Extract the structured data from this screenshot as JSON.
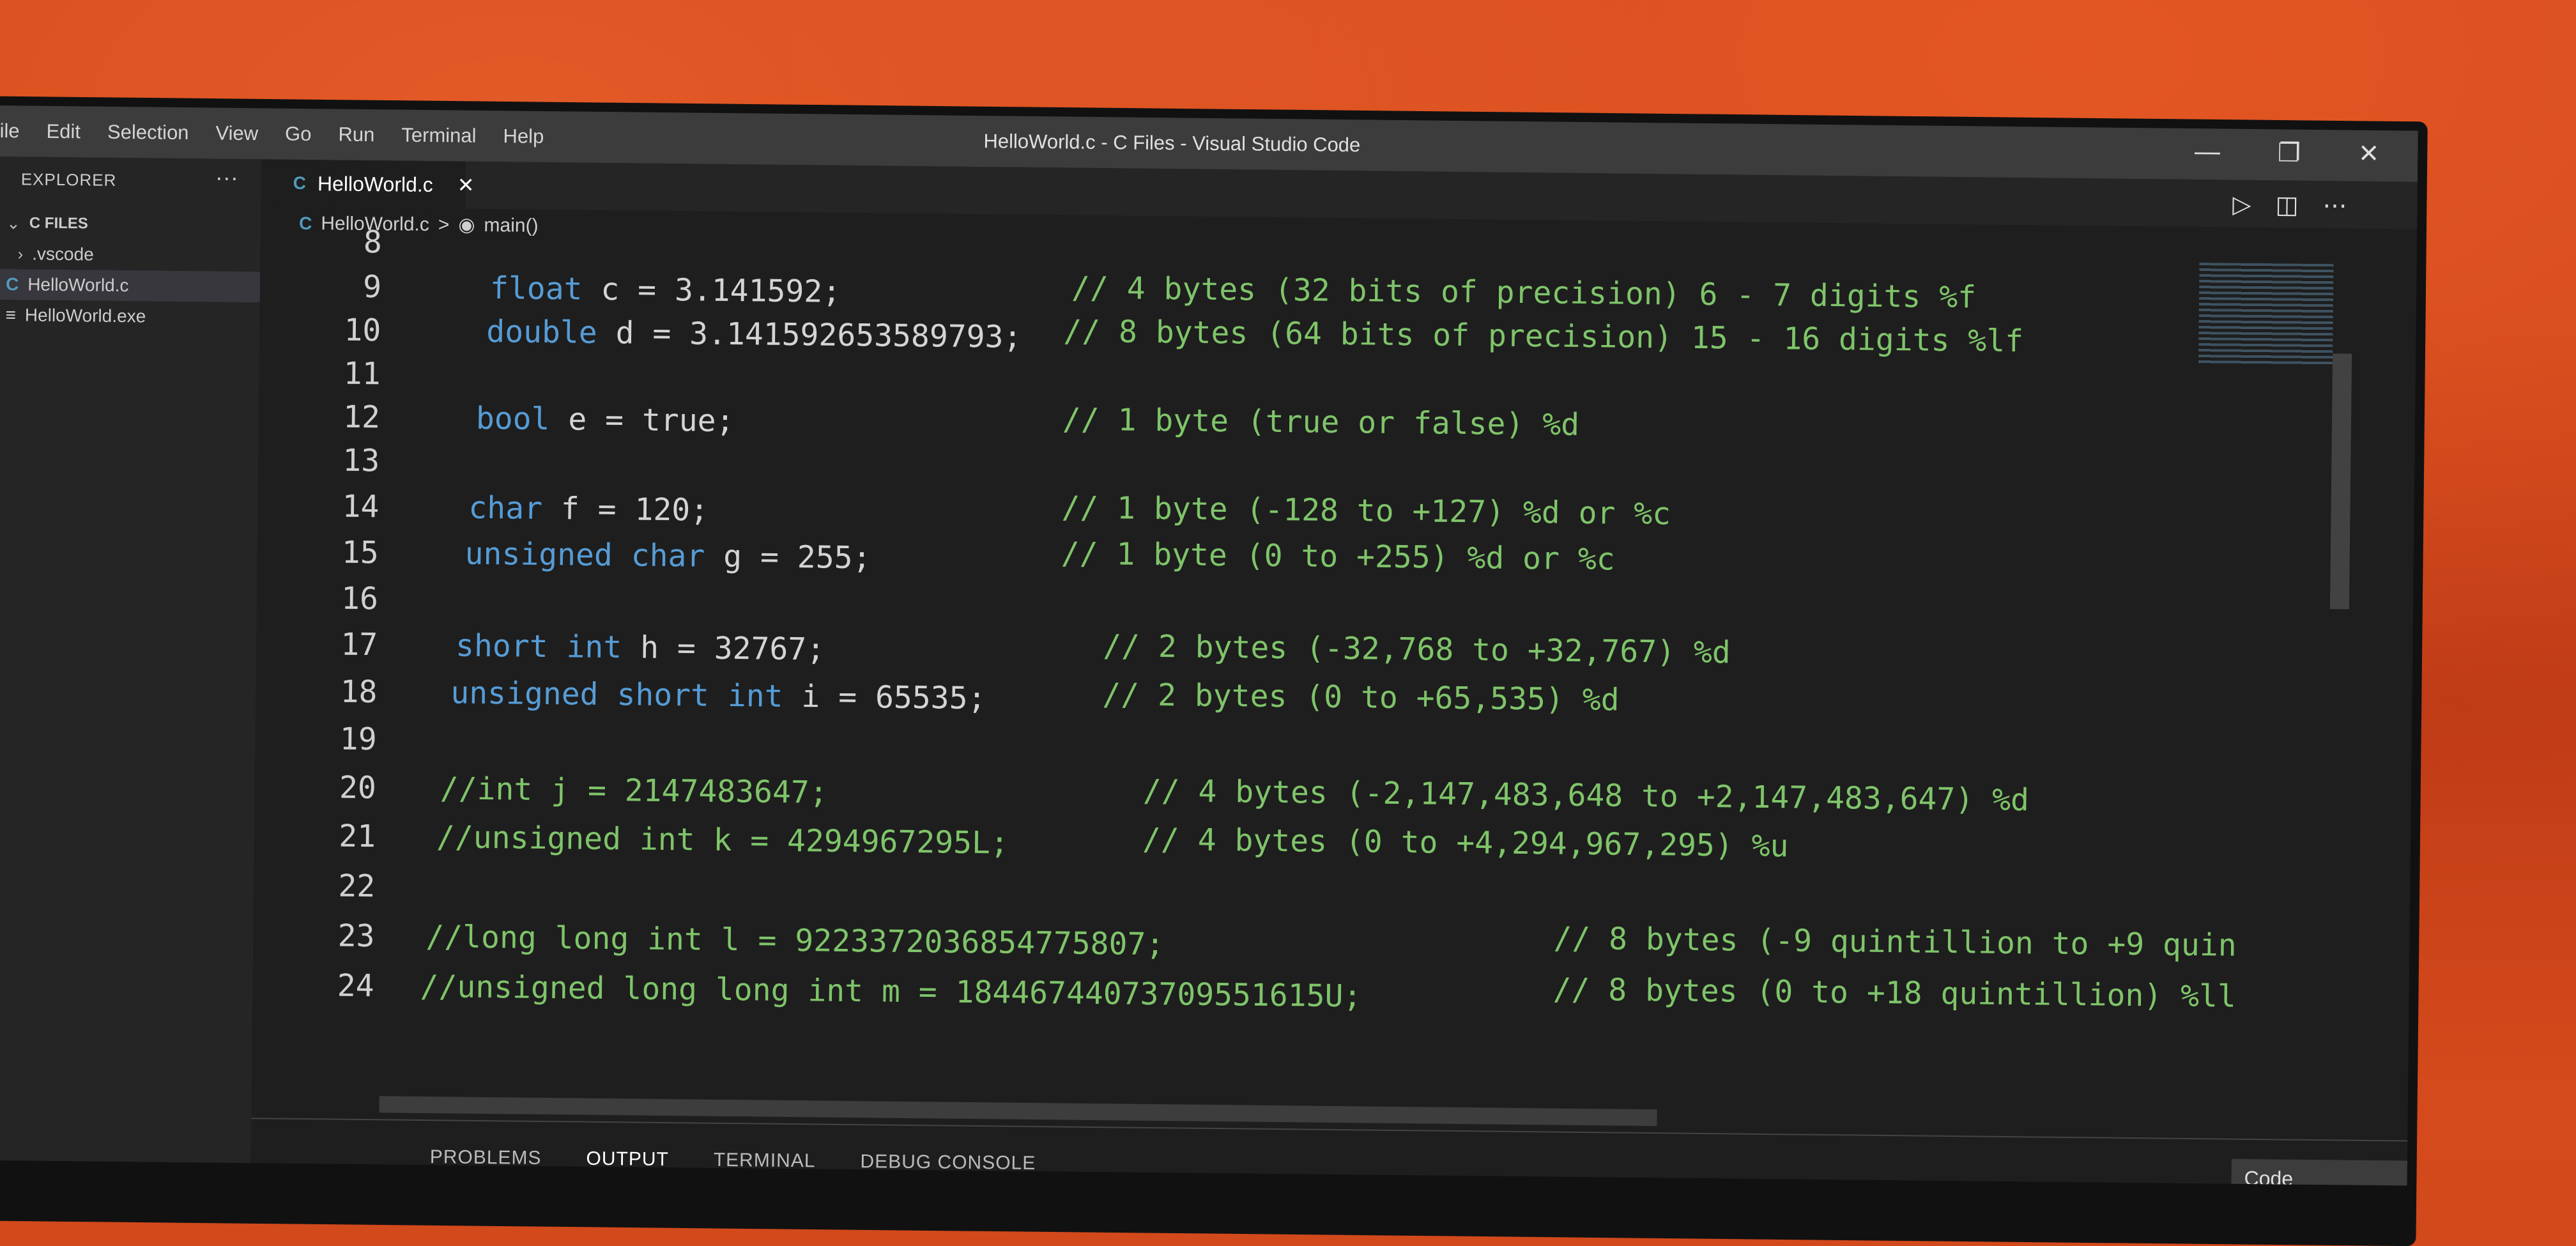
{
  "titlebar": {
    "menu": [
      "ile",
      "Edit",
      "Selection",
      "View",
      "Go",
      "Run",
      "Terminal",
      "Help"
    ],
    "title": "HelloWorld.c - C Files - Visual Studio Code"
  },
  "sidebar": {
    "header": "EXPLORER",
    "more": "···",
    "folder": "C FILES",
    "items": [
      {
        "label": ".vscode"
      },
      {
        "label": "HelloWorld.c"
      },
      {
        "label": "HelloWorld.exe"
      }
    ]
  },
  "tab": {
    "label": "HelloWorld.c"
  },
  "breadcrumb": {
    "file": "HelloWorld.c",
    "separator": ">",
    "symbol": "main()"
  },
  "editor": {
    "line_numbers": [
      "8",
      "9",
      "10",
      "11",
      "12",
      "13",
      "14",
      "15",
      "16",
      "17",
      "18",
      "19",
      "20",
      "21",
      "22",
      "23",
      "24"
    ],
    "lines": {
      "l9_type": "float",
      "l9_code": " c = 3.141592;",
      "l9_comment": "// 4 bytes (32 bits of precision) 6 - 7 digits %f",
      "l10_type": "double",
      "l10_code": " d = 3.141592653589793;",
      "l10_comment": "// 8 bytes (64 bits of precision) 15 - 16 digits %lf",
      "l12_type": "bool",
      "l12_code": " e = true;",
      "l12_comment": "// 1 byte (true or false) %d",
      "l14_type": "char",
      "l14_code": " f = 120;",
      "l14_comment": "// 1 byte (-128 to +127) %d or %c",
      "l15_type": "unsigned char",
      "l15_code": " g = 255;",
      "l15_comment": "// 1 byte (0 to +255) %d or %c",
      "l17_type": "short int",
      "l17_code": " h = 32767;",
      "l17_comment": "// 2 bytes (-32,768 to +32,767) %d",
      "l18_type": "unsigned short int",
      "l18_code": " i = 65535;",
      "l18_comment": "// 2 bytes (0 to +65,535) %d",
      "l20_code": "//int j = 2147483647;",
      "l20_comment": "// 4 bytes (-2,147,483,648 to +2,147,483,647) %d",
      "l21_code": "//unsigned int k = 4294967295L;",
      "l21_comment": "// 4 bytes (0 to +4,294,967,295) %u",
      "l23_code": "//long long int l = 9223372036854775807;",
      "l23_comment": "// 8 bytes (-9 quintillion to +9 quin",
      "l24_code": "//unsigned long long int m = 18446744073709551615U;",
      "l24_comment": "// 8 bytes (0 to +18 quintillion) %ll"
    }
  },
  "panel": {
    "tabs": [
      "PROBLEMS",
      "OUTPUT",
      "TERMINAL",
      "DEBUG CONSOLE"
    ],
    "select_value": "Code"
  }
}
